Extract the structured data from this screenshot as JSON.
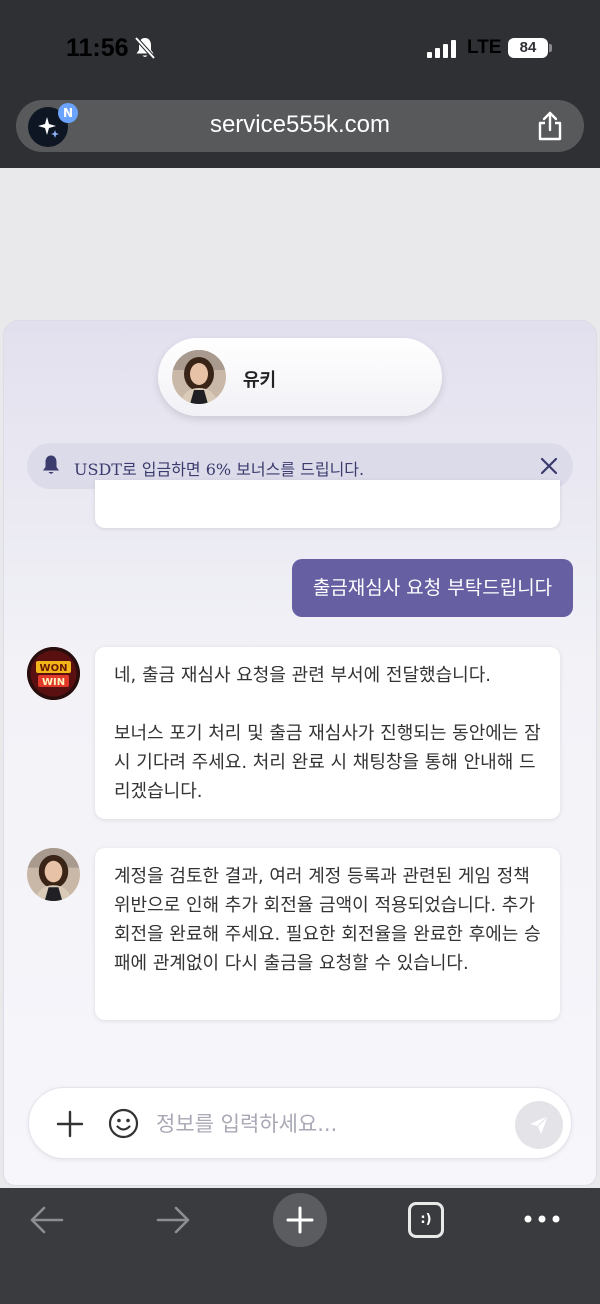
{
  "status_bar": {
    "time": "11:56",
    "network": "LTE",
    "battery": "84"
  },
  "browser": {
    "url": "service555k.com",
    "badge": "N"
  },
  "chat": {
    "agent_name": "유키",
    "notice": "USDT로 입금하면 6% 보너스를 드립니다.",
    "messages": [
      {
        "sender": "user",
        "text": "출금재심사 요청 부탁드립니다"
      },
      {
        "sender": "bot",
        "paragraphs": [
          "네, 출금 재심사 요청을 관련 부서에 전달했습니다.",
          "보너스 포기 처리 및 출금 재심사가 진행되는 동안에는 잠시 기다려 주세요. 처리 완료 시 채팅창을 통해 안내해 드리겠습니다."
        ]
      },
      {
        "sender": "agent",
        "text": "계정을 검토한 결과, 여러 계정 등록과 관련된 게임 정책 위반으로 인해 추가 회전율 금액이 적용되었습니다. 추가 회전을 완료해 주세요. 필요한 회전율을 완료한 후에는 승패에 관계없이 다시 출금을 요청할 수 있습니다."
      }
    ],
    "input": {
      "placeholder": "정보를 입력하세요...",
      "value": ""
    }
  },
  "toolbar": {
    "tabs_label": ":)"
  },
  "bot_logo_text": [
    "WON",
    "WIN"
  ],
  "colors": {
    "user_bubble": "#6660a3",
    "notice_text": "#3b3b6d",
    "browser_chrome": "#2e3033"
  }
}
